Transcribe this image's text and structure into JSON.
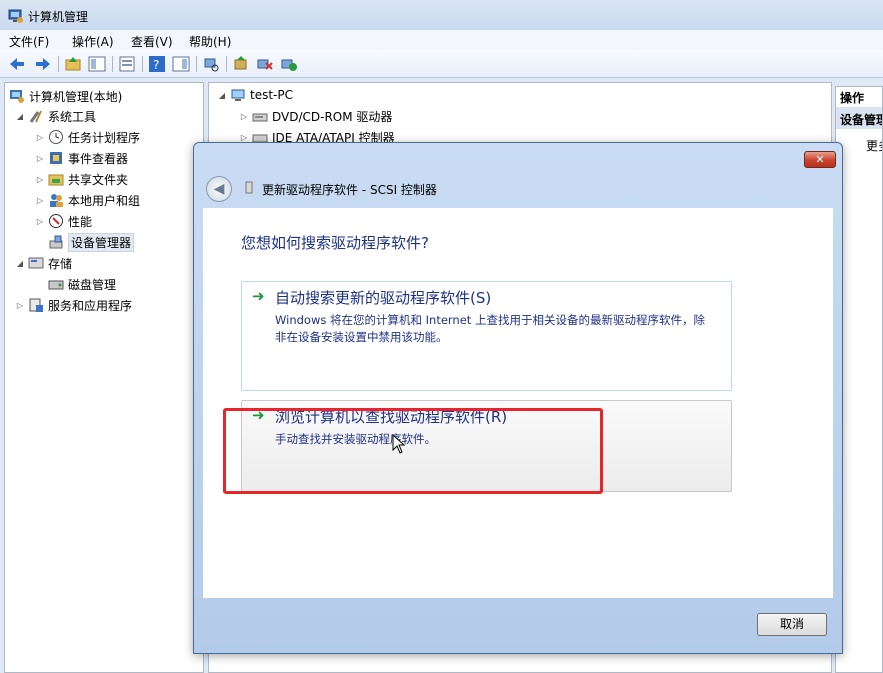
{
  "window": {
    "title": "计算机管理"
  },
  "menu": [
    "文件(F)",
    "操作(A)",
    "查看(V)",
    "帮助(H)"
  ],
  "tree": {
    "root": "计算机管理(本地)",
    "system_tools": "系统工具",
    "task_scheduler": "任务计划程序",
    "event_viewer": "事件查看器",
    "shared_folders": "共享文件夹",
    "local_users": "本地用户和组",
    "performance": "性能",
    "device_manager": "设备管理器",
    "storage": "存储",
    "disk_management": "磁盘管理",
    "services_apps": "服务和应用程序"
  },
  "devices": {
    "computer": "test-PC",
    "dvd": "DVD/CD-ROM 驱动器",
    "ide": "IDE ATA/ATAPI 控制器"
  },
  "actions": {
    "header": "操作",
    "sub_header": "设备管理器",
    "more": "更多操作"
  },
  "dialog": {
    "title": "更新驱动程序软件 - SCSI 控制器",
    "close": "✕",
    "heading": "您想如何搜索驱动程序软件?",
    "option1_title": "自动搜索更新的驱动程序软件(S)",
    "option1_desc": "Windows 将在您的计算机和 Internet 上查找用于相关设备的最新驱动程序软件，除非在设备安装设置中禁用该功能。",
    "option2_title": "浏览计算机以查找驱动程序软件(R)",
    "option2_desc": "手动查找并安装驱动程序软件。",
    "cancel": "取消"
  },
  "colors": {
    "link_blue": "#1e3287",
    "arrow_green": "#1f9a3a",
    "highlight_red": "#e8252b"
  }
}
